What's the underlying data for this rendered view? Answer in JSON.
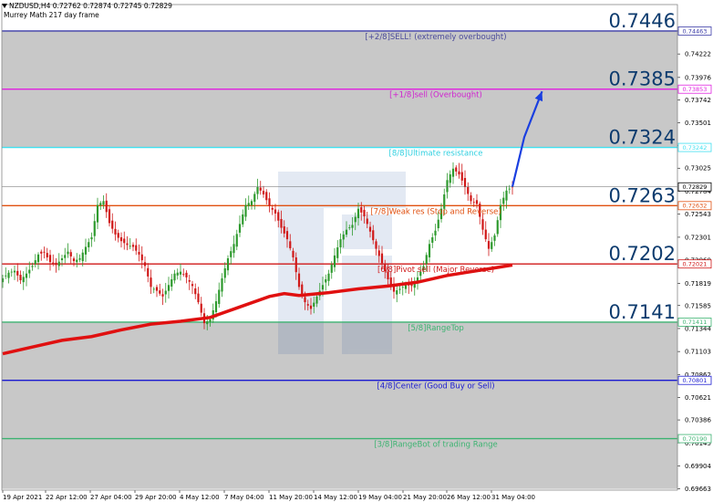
{
  "chart_header": {
    "symbol_line": "NZDUSD,H4  0.72762 0.72874 0.72745 0.72829",
    "indicator_line": "Murrey Math 217 day frame"
  },
  "colors": {
    "zone_gray": "#c8c8c8",
    "bull_candle": "#2e9a2e",
    "bear_candle": "#d01818",
    "ma_line": "#e01010",
    "forecast_arrow": "#1a3fe0",
    "big_price_text": "#0d3b6e"
  },
  "chart_data": {
    "type": "candlestick",
    "title": "NZDUSD,H4",
    "ylim": [
      0.6965,
      0.7474
    ],
    "y_ticks": [
      "0.74463",
      "0.74222",
      "0.73976",
      "0.73742",
      "0.73501",
      "0.73260",
      "0.73025",
      "0.72784",
      "0.72543",
      "0.72301",
      "0.72060",
      "0.71819",
      "0.71585",
      "0.71344",
      "0.71103",
      "0.70862",
      "0.70621",
      "0.70386",
      "0.70145",
      "0.69904",
      "0.69663"
    ],
    "x_labels": [
      "19 Apr 2021",
      "22 Apr 12:00",
      "27 Apr 04:00",
      "29 Apr 20:00",
      "4 May 12:00",
      "7 May 04:00",
      "11 May 20:00",
      "14 May 12:00",
      "19 May 04:00",
      "21 May 20:00",
      "26 May 12:00",
      "31 May 04:00"
    ],
    "current_price": "0.72829",
    "murrey_levels": [
      {
        "price": 0.74463,
        "price_label": "0.74463",
        "big_label": "0.7446",
        "label": "[+2/8]SELL! (extremely overbought)",
        "color": "#3b3ba8",
        "label_color": "#4a4a9a"
      },
      {
        "price": 0.73853,
        "price_label": "0.73853",
        "big_label": "0.7385",
        "label": "[+1/8]sell (Overbought)",
        "color": "#e020e0",
        "label_color": "#d020d0"
      },
      {
        "price": 0.73242,
        "price_label": "0.73242",
        "big_label": "0.7324",
        "label": "[8/8]Ultimate resistance",
        "color": "#40e0f0",
        "label_color": "#30d0e0"
      },
      {
        "price": 0.72632,
        "price_label": "0.72632",
        "big_label": "0.7263",
        "label": "[7/8]Weak res (Stop and Reverse)",
        "color": "#e05010",
        "label_color": "#e05010"
      },
      {
        "price": 0.72021,
        "price_label": "0.72021",
        "big_label": "0.7202",
        "label": "[6/8]Pivot sell (Major Reverse)",
        "color": "#d01818",
        "label_color": "#d01818"
      },
      {
        "price": 0.71411,
        "price_label": "0.71411",
        "big_label": "0.7141",
        "label": "[5/8]RangeTop",
        "color": "#3cb371",
        "label_color": "#3cb371"
      },
      {
        "price": 0.70801,
        "price_label": "0.70801",
        "big_label": "",
        "label": "[4/8]Center (Good Buy or Sell)",
        "color": "#1a1ad0",
        "label_color": "#1a1ad0"
      },
      {
        "price": 0.7019,
        "price_label": "0.70190",
        "big_label": "",
        "label": "[3/8]RangeBot of trading Range",
        "color": "#3cb371",
        "label_color": "#3cb371"
      }
    ],
    "shaded_zones": [
      [
        0.73242,
        0.74463
      ],
      [
        0.69663,
        0.71411
      ]
    ],
    "close_path": [
      [
        0,
        0.7187
      ],
      [
        2,
        0.7193
      ],
      [
        4,
        0.7195
      ],
      [
        6,
        0.7185
      ],
      [
        8,
        0.7192
      ],
      [
        10,
        0.72
      ],
      [
        12,
        0.7212
      ],
      [
        14,
        0.7214
      ],
      [
        16,
        0.7204
      ],
      [
        18,
        0.7201
      ],
      [
        20,
        0.7208
      ],
      [
        22,
        0.7215
      ],
      [
        24,
        0.7205
      ],
      [
        26,
        0.7208
      ],
      [
        28,
        0.722
      ],
      [
        30,
        0.723
      ],
      [
        32,
        0.7264
      ],
      [
        34,
        0.7268
      ],
      [
        36,
        0.7245
      ],
      [
        38,
        0.7233
      ],
      [
        40,
        0.7226
      ],
      [
        42,
        0.7222
      ],
      [
        44,
        0.722
      ],
      [
        46,
        0.7212
      ],
      [
        48,
        0.72
      ],
      [
        50,
        0.7178
      ],
      [
        52,
        0.7174
      ],
      [
        54,
        0.7168
      ],
      [
        56,
        0.718
      ],
      [
        58,
        0.7192
      ],
      [
        60,
        0.7194
      ],
      [
        62,
        0.7188
      ],
      [
        64,
        0.7179
      ],
      [
        66,
        0.7162
      ],
      [
        68,
        0.714
      ],
      [
        70,
        0.7144
      ],
      [
        72,
        0.7163
      ],
      [
        74,
        0.7187
      ],
      [
        76,
        0.7208
      ],
      [
        78,
        0.7223
      ],
      [
        80,
        0.7244
      ],
      [
        82,
        0.7264
      ],
      [
        84,
        0.7268
      ],
      [
        86,
        0.7283
      ],
      [
        88,
        0.7275
      ],
      [
        90,
        0.7263
      ],
      [
        92,
        0.7255
      ],
      [
        94,
        0.724
      ],
      [
        96,
        0.7228
      ],
      [
        98,
        0.7209
      ],
      [
        100,
        0.7178
      ],
      [
        102,
        0.7162
      ],
      [
        104,
        0.7155
      ],
      [
        106,
        0.7168
      ],
      [
        108,
        0.718
      ],
      [
        110,
        0.7192
      ],
      [
        112,
        0.7211
      ],
      [
        114,
        0.7228
      ],
      [
        116,
        0.7238
      ],
      [
        118,
        0.7243
      ],
      [
        120,
        0.726
      ],
      [
        122,
        0.7252
      ],
      [
        124,
        0.7236
      ],
      [
        126,
        0.7218
      ],
      [
        128,
        0.7203
      ],
      [
        130,
        0.7186
      ],
      [
        132,
        0.7173
      ],
      [
        134,
        0.7176
      ],
      [
        136,
        0.718
      ],
      [
        138,
        0.7179
      ],
      [
        140,
        0.7188
      ],
      [
        142,
        0.72
      ],
      [
        144,
        0.7223
      ],
      [
        146,
        0.7237
      ],
      [
        148,
        0.726
      ],
      [
        150,
        0.729
      ],
      [
        152,
        0.7302
      ],
      [
        154,
        0.7296
      ],
      [
        156,
        0.7283
      ],
      [
        158,
        0.7268
      ],
      [
        160,
        0.7265
      ],
      [
        162,
        0.7238
      ],
      [
        164,
        0.7218
      ],
      [
        166,
        0.7232
      ],
      [
        168,
        0.7264
      ],
      [
        170,
        0.7279
      ],
      [
        172,
        0.7283
      ]
    ],
    "moving_average": [
      [
        0,
        0.7108
      ],
      [
        10,
        0.7115
      ],
      [
        20,
        0.7122
      ],
      [
        30,
        0.7126
      ],
      [
        40,
        0.7133
      ],
      [
        50,
        0.7139
      ],
      [
        60,
        0.7142
      ],
      [
        70,
        0.7146
      ],
      [
        80,
        0.7157
      ],
      [
        90,
        0.7168
      ],
      [
        95,
        0.7171
      ],
      [
        100,
        0.7169
      ],
      [
        110,
        0.7172
      ],
      [
        120,
        0.7176
      ],
      [
        130,
        0.7179
      ],
      [
        140,
        0.7183
      ],
      [
        150,
        0.719
      ],
      [
        160,
        0.7195
      ],
      [
        172,
        0.7201
      ]
    ],
    "forecast_arrow": {
      "from": [
        172,
        0.7283
      ],
      "via": [
        176,
        0.7335
      ],
      "to": [
        182,
        0.7383
      ]
    }
  }
}
